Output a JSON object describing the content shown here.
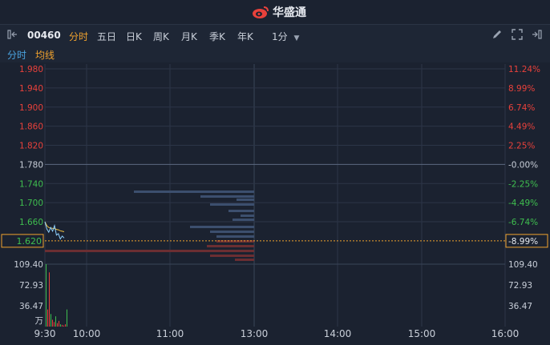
{
  "brand": {
    "name": "华盛通",
    "logo_icon": "weibo-style-eye-icon"
  },
  "toolbar": {
    "stock_code": "00460",
    "tabs": [
      {
        "label": "分时",
        "active": true
      },
      {
        "label": "五日",
        "active": false
      },
      {
        "label": "日K",
        "active": false
      },
      {
        "label": "周K",
        "active": false
      },
      {
        "label": "月K",
        "active": false
      },
      {
        "label": "季K",
        "active": false
      },
      {
        "label": "年K",
        "active": false
      }
    ],
    "interval": "1分",
    "icons": [
      "draw-pencil-icon",
      "fullscreen-icon",
      "forward-end-icon"
    ],
    "left_icon": "back-start-icon"
  },
  "subtabs": [
    {
      "label": "分时",
      "color": "#4aa3df"
    },
    {
      "label": "均线",
      "color": "#f0a22e"
    }
  ],
  "colors": {
    "up": "#e8413b",
    "down": "#3fbf4f",
    "flat": "#c9cfd9",
    "price_line": "#8fd2ff",
    "avg_line": "#f0c040",
    "grid": "#2c3547",
    "depth_bar": "#3c4f6e",
    "depth_bar_red": "#6b2e32"
  },
  "chart_data": {
    "type": "line",
    "price_axis_left": [
      "1.980",
      "1.940",
      "1.900",
      "1.860",
      "1.820",
      "1.780",
      "1.740",
      "1.700",
      "1.660"
    ],
    "price_axis_right": [
      "11.24%",
      "8.99%",
      "6.74%",
      "4.49%",
      "2.25%",
      "-0.00%",
      "-2.25%",
      "-4.49%",
      "-6.74%"
    ],
    "prev_close": 1.78,
    "current_price": "1.620",
    "current_pct": "-8.99%",
    "volume_axis": [
      "109.40",
      "72.93",
      "36.47"
    ],
    "volume_unit": "万",
    "time_labels": [
      "9:30",
      "10:00",
      "11:00",
      "13:00",
      "14:00",
      "15:00",
      "16:00"
    ],
    "price_series": [
      1.66,
      1.645,
      1.638,
      1.648,
      1.64,
      1.652,
      1.632,
      1.635,
      1.624,
      1.63,
      1.626
    ],
    "avg_series": [
      1.66,
      1.652,
      1.648,
      1.647,
      1.646,
      1.646,
      1.644,
      1.643,
      1.641,
      1.64,
      1.639
    ],
    "volumes": [
      109.4,
      30,
      95,
      22,
      12,
      8,
      18,
      6,
      10,
      4,
      3,
      2,
      4,
      30
    ],
    "volume_up": [
      true,
      false,
      false,
      true,
      false,
      false,
      true,
      false,
      false,
      true,
      false,
      false,
      false,
      true
    ]
  }
}
